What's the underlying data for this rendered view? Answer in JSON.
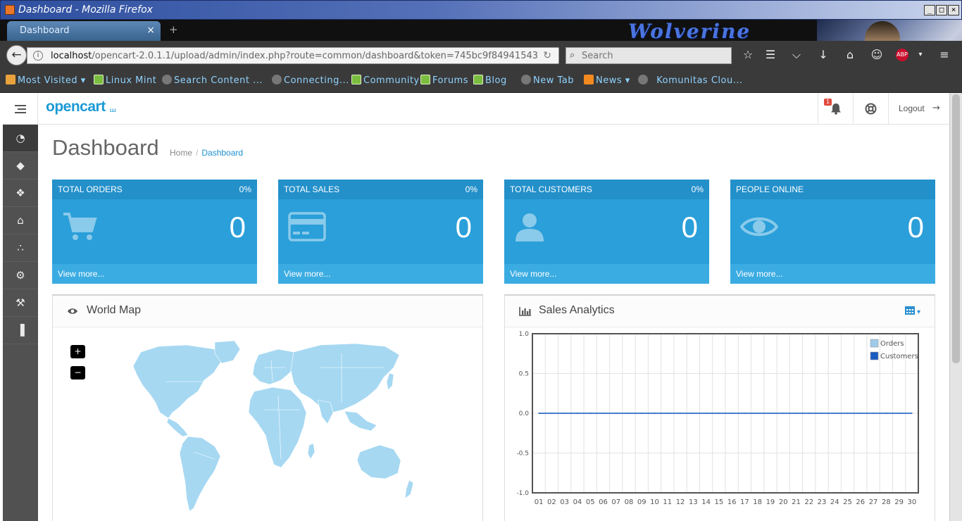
{
  "window": {
    "title": "Dashboard - Mozilla Firefox",
    "controls": [
      "_",
      "□",
      "×"
    ]
  },
  "browser": {
    "tab_title": "Dashboard",
    "tab_close": "×",
    "new_tab": "+",
    "theme_text": "Wolverine",
    "url_host": "localhost",
    "url_path": "/opencart-2.0.1.1/upload/admin/index.php?route=common/dashboard&token=745bc9f84941543",
    "search_placeholder": "Search",
    "bookmarks": [
      {
        "label": "Most Visited ▾",
        "icon": "folder"
      },
      {
        "label": "Linux Mint",
        "icon": "mint"
      },
      {
        "label": "Search Content ...",
        "icon": "globe"
      },
      {
        "label": "Connecting...",
        "icon": "globe"
      },
      {
        "label": "Community",
        "icon": "mint"
      },
      {
        "label": "Forums",
        "icon": "mint"
      },
      {
        "label": "Blog",
        "icon": "mint"
      },
      {
        "label": "New Tab",
        "icon": "globe"
      },
      {
        "label": "News ▾",
        "icon": "rss"
      },
      {
        "label": "Komunitas Clou...",
        "icon": "globe"
      }
    ]
  },
  "header": {
    "logo": "opencart",
    "notification_count": "1",
    "logout_label": "Logout"
  },
  "page": {
    "title": "Dashboard",
    "breadcrumb_home": "Home",
    "breadcrumb_sep": "/",
    "breadcrumb_current": "Dashboard"
  },
  "tiles": [
    {
      "title": "TOTAL ORDERS",
      "pct": "0%",
      "value": "0",
      "more": "View more...",
      "icon": "cart-icon"
    },
    {
      "title": "TOTAL SALES",
      "pct": "0%",
      "value": "0",
      "more": "View more...",
      "icon": "credit-card-icon"
    },
    {
      "title": "TOTAL CUSTOMERS",
      "pct": "0%",
      "value": "0",
      "more": "View more...",
      "icon": "user-icon"
    },
    {
      "title": "PEOPLE ONLINE",
      "pct": "",
      "value": "0",
      "more": "View more...",
      "icon": "eye-icon"
    }
  ],
  "world_map": {
    "title": "World Map",
    "zoom_in": "+",
    "zoom_out": "−",
    "fill_color": "#a6d8f2"
  },
  "sales": {
    "title": "Sales Analytics"
  },
  "chart_data": {
    "type": "line",
    "title": "",
    "xlabel": "",
    "ylabel": "",
    "x": [
      "01",
      "02",
      "03",
      "04",
      "05",
      "06",
      "07",
      "08",
      "09",
      "10",
      "11",
      "12",
      "13",
      "14",
      "15",
      "16",
      "17",
      "18",
      "19",
      "20",
      "21",
      "22",
      "23",
      "24",
      "25",
      "26",
      "27",
      "28",
      "29",
      "30"
    ],
    "yticks": [
      "1.0",
      "0.5",
      "0.0",
      "-0.5",
      "-1.0"
    ],
    "ylim": [
      -1,
      1
    ],
    "grid": true,
    "legend_position": "top-right",
    "series": [
      {
        "name": "Orders",
        "color": "#9fcbe9",
        "values": [
          0,
          0,
          0,
          0,
          0,
          0,
          0,
          0,
          0,
          0,
          0,
          0,
          0,
          0,
          0,
          0,
          0,
          0,
          0,
          0,
          0,
          0,
          0,
          0,
          0,
          0,
          0,
          0,
          0,
          0
        ]
      },
      {
        "name": "Customers",
        "color": "#1a5bbf",
        "values": [
          0,
          0,
          0,
          0,
          0,
          0,
          0,
          0,
          0,
          0,
          0,
          0,
          0,
          0,
          0,
          0,
          0,
          0,
          0,
          0,
          0,
          0,
          0,
          0,
          0,
          0,
          0,
          0,
          0,
          0
        ]
      }
    ]
  }
}
